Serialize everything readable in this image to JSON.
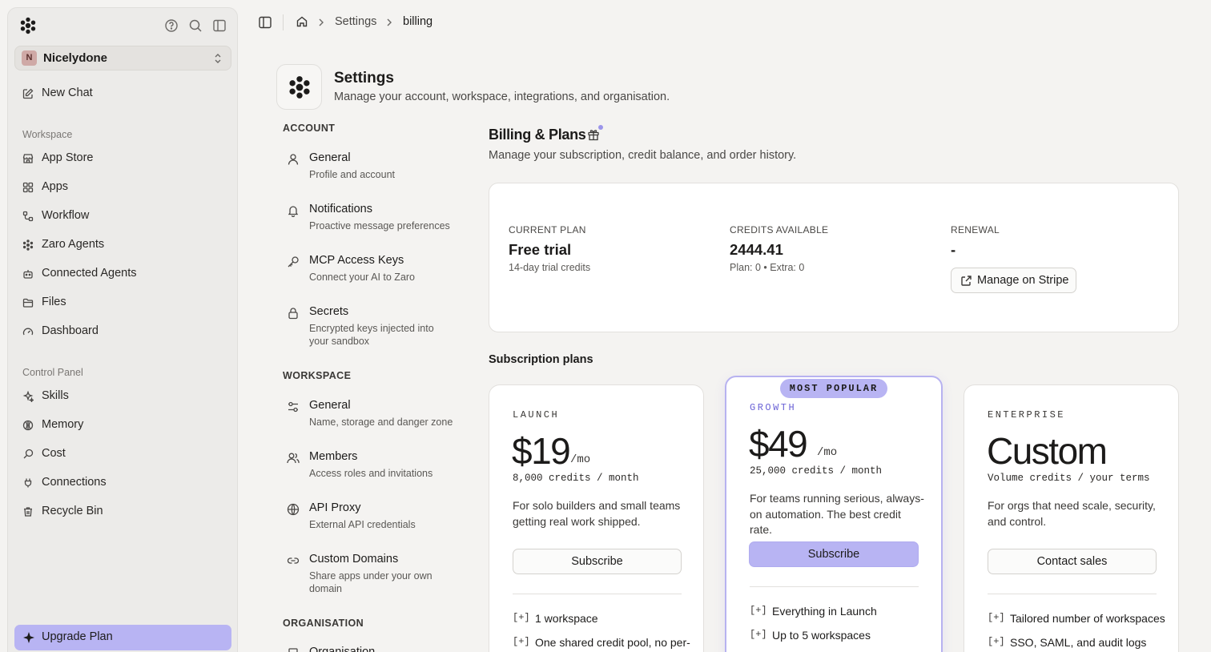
{
  "sidebar": {
    "workspace_initial": "N",
    "workspace_name": "Nicelydone",
    "new_chat": "New Chat",
    "workspace_label": "Workspace",
    "workspace_items": [
      "App Store",
      "Apps",
      "Workflow",
      "Zaro Agents",
      "Connected Agents",
      "Files",
      "Dashboard"
    ],
    "control_label": "Control Panel",
    "control_items": [
      "Skills",
      "Memory",
      "Cost",
      "Connections",
      "Recycle Bin"
    ],
    "upgrade": "Upgrade Plan"
  },
  "breadcrumb": {
    "settings": "Settings",
    "current": "billing"
  },
  "header": {
    "title": "Settings",
    "subtitle": "Manage your account, workspace, integrations, and organisation."
  },
  "settings_nav": {
    "account_label": "ACCOUNT",
    "account": [
      {
        "title": "General",
        "desc": "Profile and account"
      },
      {
        "title": "Notifications",
        "desc": "Proactive message preferences"
      },
      {
        "title": "MCP Access Keys",
        "desc": "Connect your AI to Zaro"
      },
      {
        "title": "Secrets",
        "desc": "Encrypted keys injected into your sandbox"
      }
    ],
    "workspace_label": "WORKSPACE",
    "workspace": [
      {
        "title": "General",
        "desc": "Name, storage and danger zone"
      },
      {
        "title": "Members",
        "desc": "Access roles and invitations"
      },
      {
        "title": "API Proxy",
        "desc": "External API credentials"
      },
      {
        "title": "Custom Domains",
        "desc": "Share apps under your own domain"
      }
    ],
    "org_label": "ORGANISATION",
    "org_first": "Organisation"
  },
  "billing": {
    "title": "Billing & Plans",
    "subtitle": "Manage your subscription, credit balance, and order history.",
    "current_plan_label": "CURRENT PLAN",
    "current_plan": "Free trial",
    "current_plan_note": "14-day trial credits",
    "credits_label": "CREDITS AVAILABLE",
    "credits": "2444.41",
    "credits_note": "Plan: 0 • Extra: 0",
    "renewal_label": "RENEWAL",
    "renewal": "-",
    "stripe_button": "Manage on Stripe"
  },
  "plans": {
    "title": "Subscription plans",
    "popular_badge": "MOST POPULAR",
    "tiers": [
      {
        "name": "LAUNCH",
        "price": "$19",
        "period": "/mo",
        "credits": "8,000 credits / month",
        "desc": "For solo builders and small teams getting real work shipped.",
        "button": "Subscribe",
        "mark": "[+]",
        "features": [
          "1 workspace",
          "One shared credit pool, no per-"
        ]
      },
      {
        "name": "GROWTH",
        "price": "$49",
        "period": "/mo",
        "credits": "25,000 credits / month",
        "desc": "For teams running serious, always-on automation. The best credit rate.",
        "button": "Subscribe",
        "mark": "[+]",
        "features": [
          "Everything in Launch",
          "Up to 5 workspaces"
        ]
      },
      {
        "name": "ENTERPRISE",
        "price": "Custom",
        "period": "",
        "credits": "Volume credits / your terms",
        "desc": "For orgs that need scale, security, and control.",
        "button": "Contact sales",
        "mark": "[+]",
        "features": [
          "Tailored number of workspaces",
          "SSO, SAML, and audit logs"
        ]
      }
    ]
  },
  "colors": {
    "accent": "#b8b4f3",
    "accent_text": "#6a62d6",
    "background": "#f4f3f1",
    "sidebar": "#ecebe9"
  },
  "icons": [
    "logo-icon",
    "help-icon",
    "search-icon",
    "panel-icon",
    "chevron-updown-icon",
    "edit-icon",
    "store-icon",
    "apps-icon",
    "workflow-icon",
    "agents-icon",
    "bot-icon",
    "folder-icon",
    "gauge-icon",
    "sparkle-icon",
    "globe-icon",
    "link-icon",
    "plug-icon",
    "trash-icon",
    "home-icon",
    "chevron-right-icon",
    "user-icon",
    "bell-icon",
    "key-icon",
    "lock-icon",
    "sliders-icon",
    "users-icon",
    "gift-icon",
    "external-link-icon"
  ]
}
